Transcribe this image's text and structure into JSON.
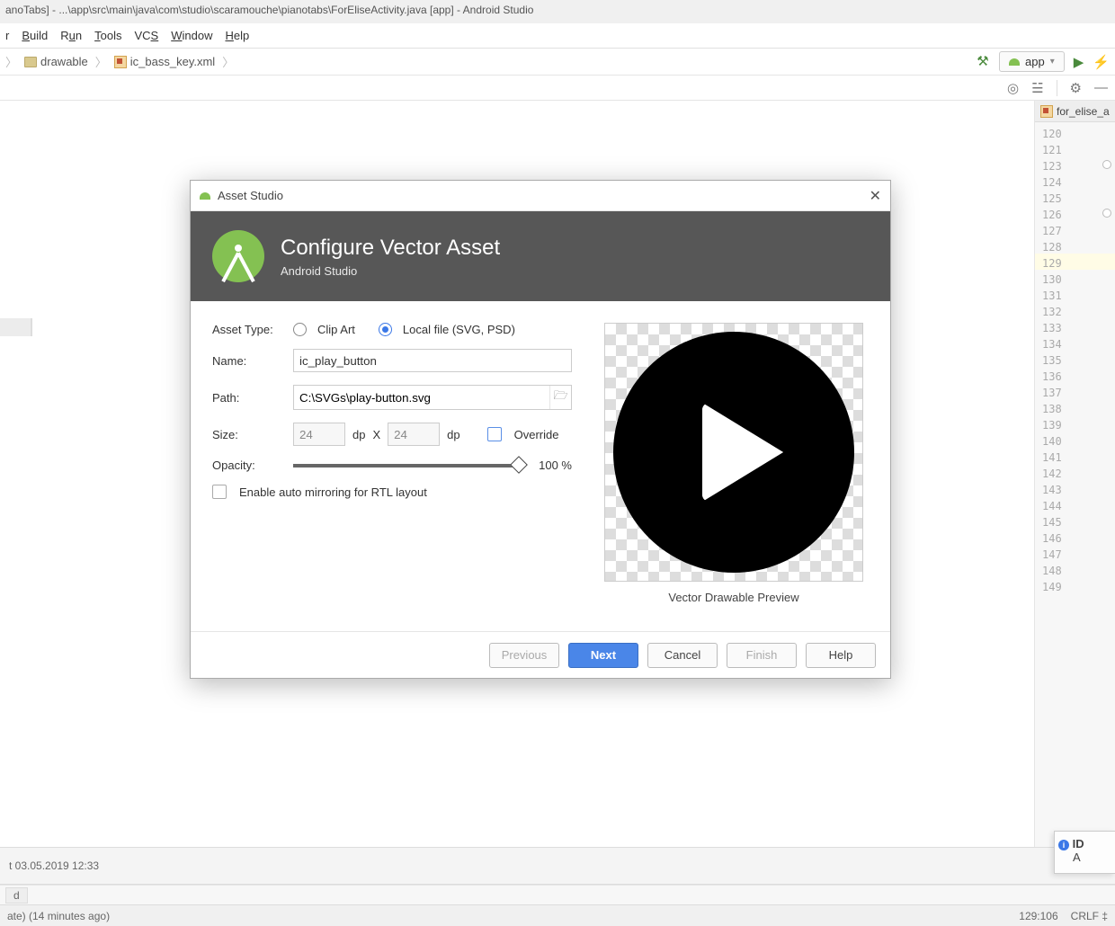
{
  "window": {
    "title": "anoTabs] - ...\\app\\src\\main\\java\\com\\studio\\scaramouche\\pianotabs\\ForEliseActivity.java [app] - Android Studio"
  },
  "menu": [
    "r",
    "Build",
    "Run",
    "Tools",
    "VCS",
    "Window",
    "Help"
  ],
  "breadcrumbs": [
    {
      "icon": "folder",
      "label": "drawable"
    },
    {
      "icon": "xml",
      "label": "ic_bass_key.xml"
    }
  ],
  "runConfig": {
    "label": "app"
  },
  "editorTab": "for_elise_a",
  "lineNumbers": [
    120,
    121,
    123,
    124,
    125,
    126,
    127,
    128,
    129,
    130,
    131,
    132,
    133,
    134,
    135,
    136,
    137,
    138,
    139,
    140,
    141,
    142,
    143,
    144,
    145,
    146,
    147,
    148,
    149
  ],
  "highlightLine": 129,
  "bottomTool": "t 03.05.2019 12:33",
  "bottomTab": "d",
  "statusLeft": "ate) (14 minutes ago)",
  "statusRight": {
    "pos": "129:106",
    "enc": "CRLF ‡"
  },
  "idePopup": {
    "title": "ID",
    "body": "A"
  },
  "dialog": {
    "title": "Asset Studio",
    "header": "Configure Vector Asset",
    "subheader": "Android Studio",
    "assetTypeLabel": "Asset Type:",
    "clipArt": "Clip Art",
    "localFile": "Local file (SVG, PSD)",
    "nameLabel": "Name:",
    "nameValue": "ic_play_button",
    "pathLabel": "Path:",
    "pathValue": "C:\\SVGs\\play-button.svg",
    "sizeLabel": "Size:",
    "sizeW": "24",
    "sizeH": "24",
    "dpW": "dp",
    "dpH": "dp",
    "xSep": "X",
    "override": "Override",
    "opacityLabel": "Opacity:",
    "opacityValue": "100 %",
    "rtl": "Enable auto mirroring for RTL layout",
    "previewLabel": "Vector Drawable Preview",
    "buttons": {
      "previous": "Previous",
      "next": "Next",
      "cancel": "Cancel",
      "finish": "Finish",
      "help": "Help"
    }
  }
}
